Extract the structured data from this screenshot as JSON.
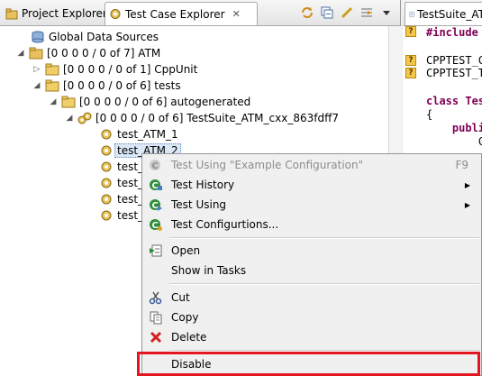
{
  "view": {
    "tabs": [
      {
        "label": "Project Explorer",
        "icon": "project-explorer-icon"
      },
      {
        "label": "Test Case Explorer",
        "icon": "test-case-explorer-icon",
        "close": "✕"
      }
    ],
    "toolbar": [
      "refresh-icon",
      "collapse-icon",
      "link-icon",
      "filter-icon",
      "view-menu-icon"
    ]
  },
  "tree": {
    "global_data_sources": "Global Data Sources",
    "atm": "[0 0 0 0 / 0 of 7]  ATM",
    "cppunit": "[0 0 0 0 / 0 of 1]  CppUnit",
    "tests": "[0 0 0 0 / 0 of 6]  tests",
    "autogenerated": "[0 0 0 0 / 0 of 6]  autogenerated",
    "suite": "[0 0 0 0 / 0 of 6]  TestSuite_ATM_cxx_863fdff7",
    "cases": [
      "test_ATM_1",
      "test_ATM_2",
      "test_f",
      "test_f",
      "test_v",
      "test_v"
    ]
  },
  "editor": {
    "tab_label": "TestSuite_AT",
    "lines": [
      "#include",
      "",
      "CPPTEST_C",
      "CPPTEST_T",
      "",
      "class Tes",
      "{",
      "    publi",
      "        C"
    ]
  },
  "menu": {
    "items": [
      {
        "label": "Test Using \"Example Configuration\"",
        "accel": "F9",
        "disabled": true
      },
      {
        "label": "Test History",
        "submenu": "▶"
      },
      {
        "label": "Test Using",
        "submenu": "▶"
      },
      {
        "label": "Test Configurtions..."
      },
      {
        "label": "Open"
      },
      {
        "label": "Show in Tasks"
      },
      {
        "label": "Cut"
      },
      {
        "label": "Copy"
      },
      {
        "label": "Delete"
      },
      {
        "label": "Disable"
      }
    ]
  },
  "colors": {
    "highlight": "#e3151f",
    "selection": "#dbe8f7"
  }
}
